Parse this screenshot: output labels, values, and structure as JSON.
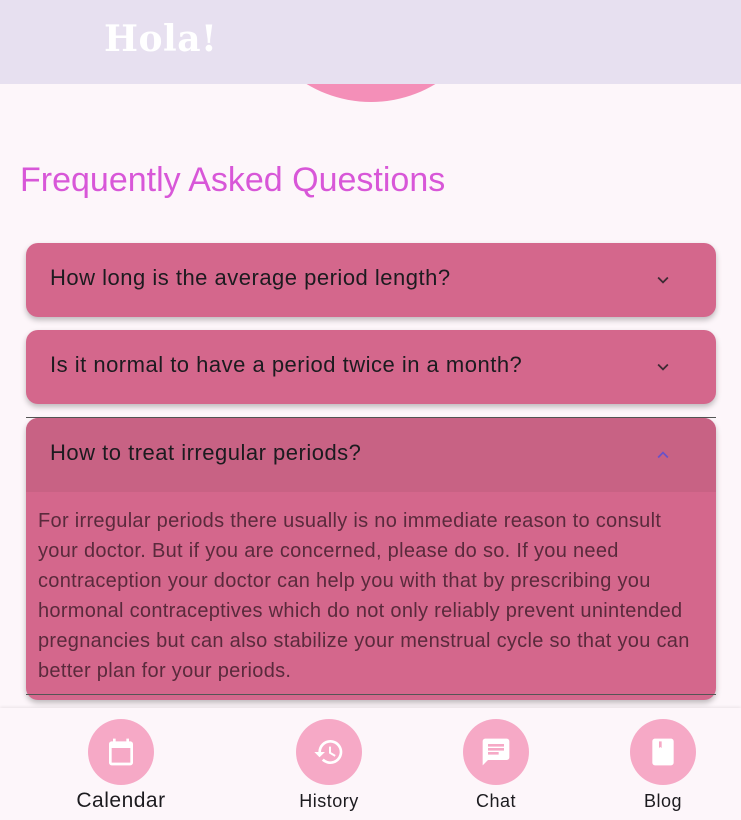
{
  "appbar": {
    "title": "Hola!"
  },
  "faq": {
    "heading": "Frequently Asked Questions",
    "items": [
      {
        "question": "How long is the average period length?",
        "expanded": false
      },
      {
        "question": "Is it normal to have a period twice in a month?",
        "expanded": false
      },
      {
        "question": "How to treat irregular periods?",
        "expanded": true,
        "answer": "For irregular periods there usually is no immediate reason to consult your doctor. But if you are concerned, please do so. If you need contraception your doctor can help you with that by prescribing you hormonal contraceptives which do not only reliably prevent unintended pregnancies but can also stabilize your menstrual cycle so that you can better plan for your periods."
      }
    ]
  },
  "nav": {
    "items": [
      {
        "label": "Calendar",
        "icon": "calendar-icon",
        "active": true
      },
      {
        "label": "History",
        "icon": "history-icon",
        "active": false
      },
      {
        "label": "Chat",
        "icon": "chat-icon",
        "active": false
      },
      {
        "label": "Blog",
        "icon": "book-icon",
        "active": false
      }
    ]
  },
  "colors": {
    "accent": "#d857d8",
    "panel": "#d4678c",
    "nav_circle": "#f6a9c6",
    "blob": "#f48fb8",
    "appbar": "#e7e0f0"
  }
}
